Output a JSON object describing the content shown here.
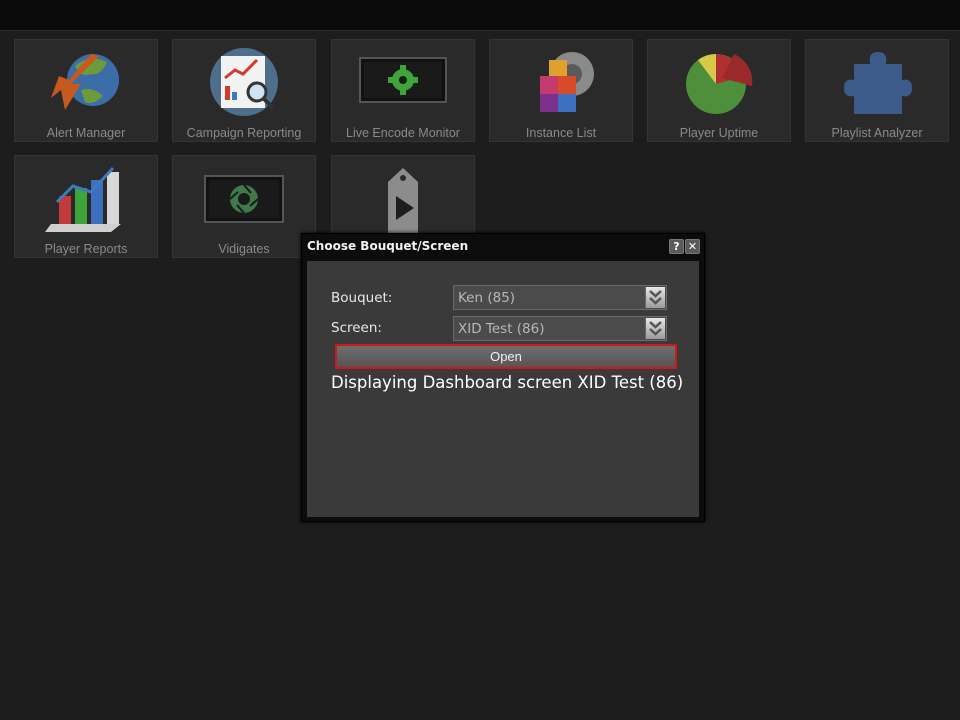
{
  "apps": [
    {
      "label": "Alert Manager",
      "icon": "globe-arrow-icon"
    },
    {
      "label": "Campaign Reporting",
      "icon": "report-magnifier-icon"
    },
    {
      "label": "Live Encode Monitor",
      "icon": "monitor-gear-icon"
    },
    {
      "label": "Instance List",
      "icon": "cubes-gear-icon"
    },
    {
      "label": "Player Uptime",
      "icon": "pie-chart-icon"
    },
    {
      "label": "Playlist Analyzer",
      "icon": "puzzle-piece-icon"
    },
    {
      "label": "Player Reports",
      "icon": "bar-chart-icon"
    },
    {
      "label": "Vidigates",
      "icon": "monitor-shutter-icon"
    },
    {
      "label": "",
      "icon": "tag-play-icon"
    }
  ],
  "dialog": {
    "title": "Choose Bouquet/Screen",
    "help_button": "?",
    "close_button": "✕",
    "bouquet_label": "Bouquet:",
    "bouquet_value": "Ken (85)",
    "screen_label": "Screen:",
    "screen_value": "XID Test (86)",
    "open_label": "Open",
    "status_text": "Displaying Dashboard screen XID Test (86)"
  },
  "colors": {
    "highlight": "#d01818",
    "background": "#1d1d1d",
    "tile": "#2a2a2a"
  }
}
